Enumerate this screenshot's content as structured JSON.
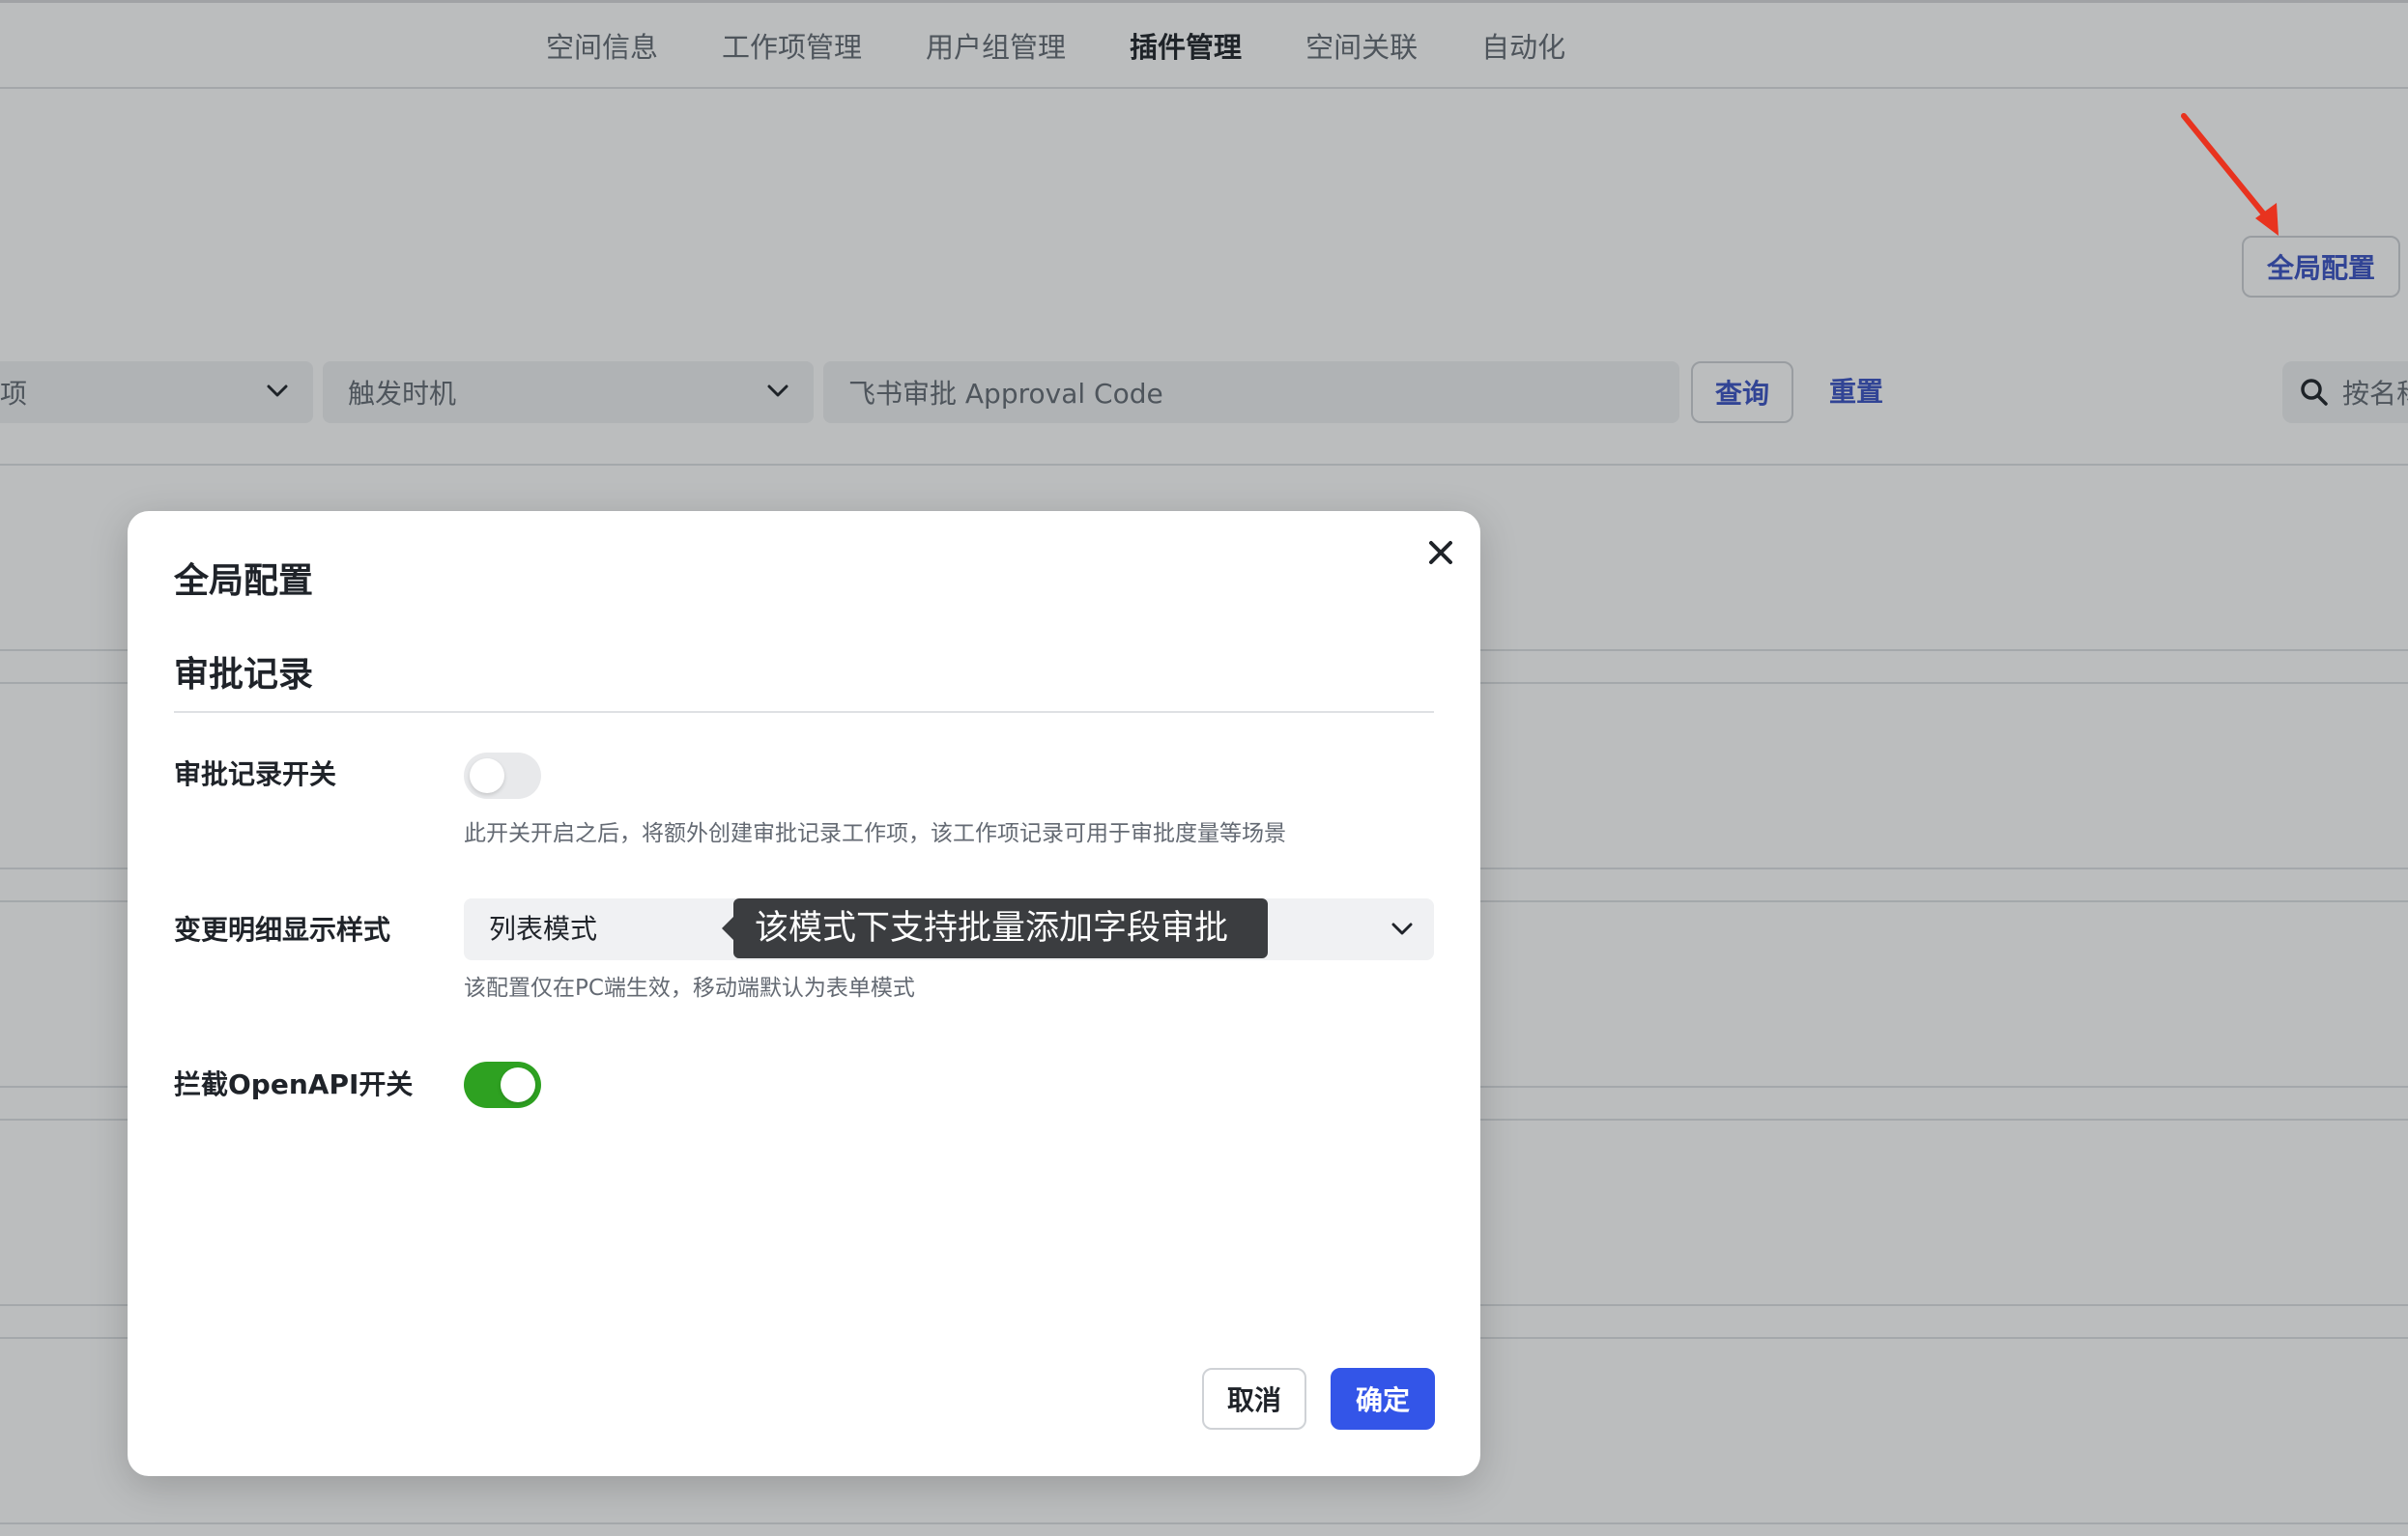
{
  "nav": {
    "tabs": [
      {
        "label": "空间信息"
      },
      {
        "label": "工作项管理"
      },
      {
        "label": "用户组管理"
      },
      {
        "label": "插件管理",
        "active": true
      },
      {
        "label": "空间关联"
      },
      {
        "label": "自动化"
      }
    ]
  },
  "toolbar": {
    "global_config_label": "全局配置",
    "filters": {
      "field1_value": "项",
      "trigger_placeholder": "触发时机",
      "approval_code_placeholder": "飞书审批 Approval Code"
    },
    "query_label": "查询",
    "reset_label": "重置",
    "search_placeholder": "按名称"
  },
  "modal": {
    "title": "全局配置",
    "section_title": "审批记录",
    "rows": [
      {
        "label": "审批记录开关",
        "type": "switch",
        "on": false,
        "hint": "此开关开启之后，将额外创建审批记录工作项，该工作项记录可用于审批度量等场景"
      },
      {
        "label": "变更明细显示样式",
        "type": "select",
        "value": "列表模式",
        "hint": "该配置仅在PC端生效，移动端默认为表单模式"
      },
      {
        "label": "拦截OpenAPI开关",
        "type": "switch",
        "on": true
      }
    ],
    "tooltip": "该模式下支持批量添加字段审批",
    "cancel_label": "取消",
    "confirm_label": "确定"
  },
  "colors": {
    "accent": "#3355e8",
    "link": "#3a52c4",
    "switch_on": "#2ea121",
    "annotation_arrow": "#e8331f"
  },
  "icons": [
    "chevron-down-icon",
    "search-icon",
    "close-icon",
    "annotation-arrow"
  ]
}
